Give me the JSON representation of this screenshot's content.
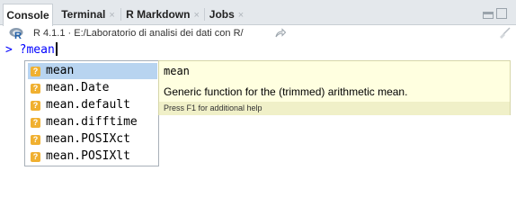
{
  "tabs": [
    {
      "label": "Console",
      "closable": false,
      "active": true
    },
    {
      "label": "Terminal",
      "closable": true,
      "active": false
    },
    {
      "label": "R Markdown",
      "closable": true,
      "active": false
    },
    {
      "label": "Jobs",
      "closable": true,
      "active": false
    }
  ],
  "close_glyph": "×",
  "path_bar": {
    "icon": "r-logo-icon",
    "text": "R 4.1.1 · E:/Laboratorio di analisi dei dati con R/"
  },
  "console": {
    "prompt": ">",
    "input": "?mean"
  },
  "completion": {
    "items": [
      {
        "label": "mean",
        "icon": "help-topic-icon",
        "selected": true
      },
      {
        "label": "mean.Date",
        "icon": "help-topic-icon",
        "selected": false
      },
      {
        "label": "mean.default",
        "icon": "help-topic-icon",
        "selected": false
      },
      {
        "label": "mean.difftime",
        "icon": "help-topic-icon",
        "selected": false
      },
      {
        "label": "mean.POSIXct",
        "icon": "help-topic-icon",
        "selected": false
      },
      {
        "label": "mean.POSIXlt",
        "icon": "help-topic-icon",
        "selected": false
      }
    ],
    "icon_glyph": "?"
  },
  "help_popup": {
    "name": "mean",
    "description": "Generic function for the (trimmed) arithmetic mean.",
    "hint": "Press F1 for additional help"
  },
  "colors": {
    "prompt": "#0000ff",
    "selection": "#b8d4f0",
    "help_bg": "#ffffe0",
    "topic_icon": "#f0b030"
  }
}
